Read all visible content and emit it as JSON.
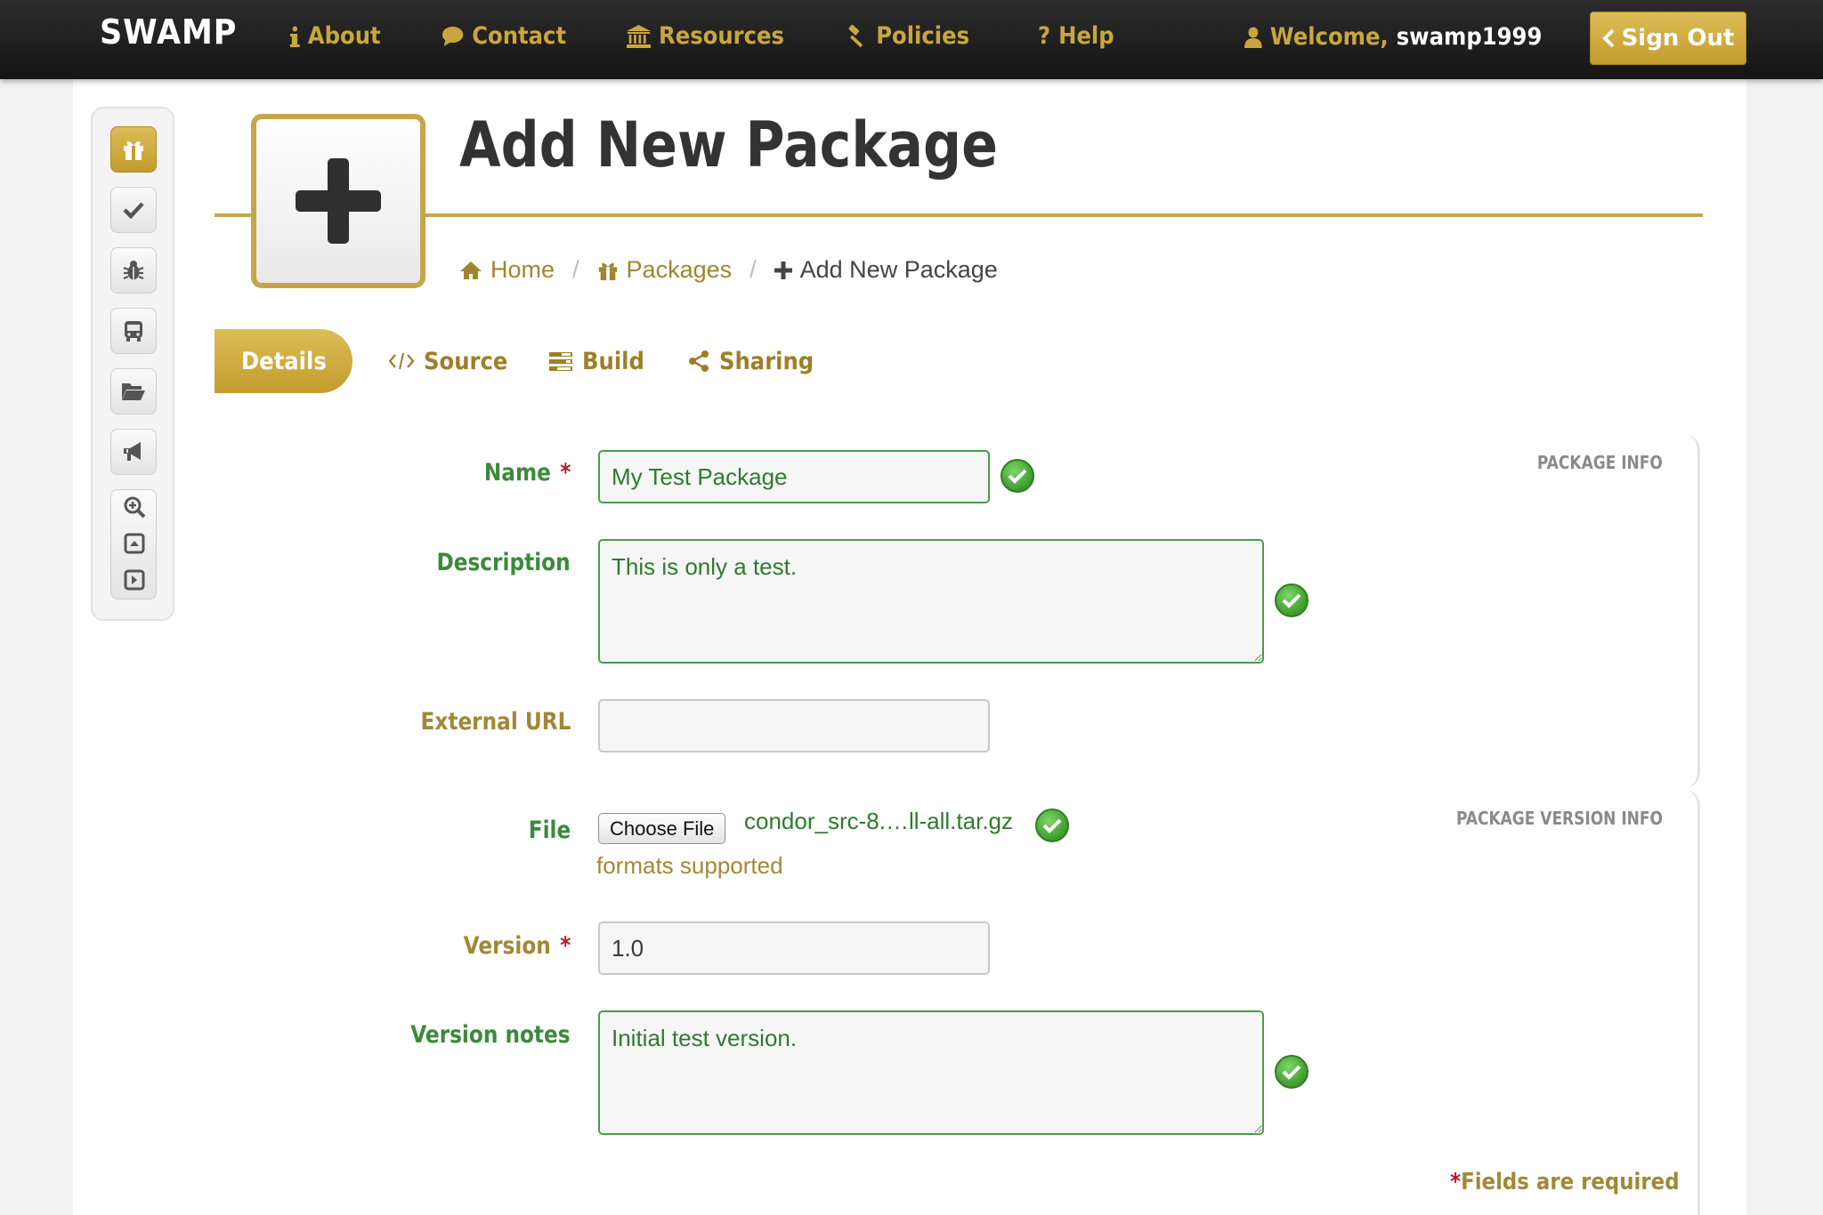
{
  "header": {
    "brand": "SWAMP",
    "nav": [
      {
        "label": "About",
        "icon": "info-icon"
      },
      {
        "label": "Contact",
        "icon": "chat-bubble-icon"
      },
      {
        "label": "Resources",
        "icon": "institution-icon"
      },
      {
        "label": "Policies",
        "icon": "gavel-icon"
      },
      {
        "label": "Help",
        "icon": "question-icon"
      }
    ],
    "welcome_prefix": "Welcome,",
    "username": "swamp1999",
    "sign_out_label": "Sign Out"
  },
  "sidebar": {
    "icons": [
      "gift-icon",
      "check-icon",
      "bug-icon",
      "bus-icon",
      "folder-open-icon",
      "bullhorn-icon",
      "zoom-in-icon",
      "collapse-up-icon",
      "expand-right-icon"
    ],
    "active": "gift-icon"
  },
  "page": {
    "title": "Add New Package",
    "breadcrumb": [
      {
        "label": "Home",
        "icon": "home-icon"
      },
      {
        "label": "Packages",
        "icon": "gift-icon"
      },
      {
        "label": "Add New Package",
        "icon": "plus-icon"
      }
    ]
  },
  "tabs": [
    {
      "label": "Details",
      "icon": "search-icon",
      "active": true
    },
    {
      "label": "Source",
      "icon": "code-icon",
      "active": false
    },
    {
      "label": "Build",
      "icon": "tasks-icon",
      "active": false
    },
    {
      "label": "Sharing",
      "icon": "share-icon",
      "active": false
    }
  ],
  "sections": {
    "package_info": "PACKAGE INFO",
    "package_version_info": "PACKAGE VERSION INFO"
  },
  "form": {
    "name": {
      "label": "Name",
      "value": "My Test Package",
      "required_mark": "*",
      "valid": true
    },
    "description": {
      "label": "Description",
      "value": "This is only a test.",
      "valid": true
    },
    "external_url": {
      "label": "External URL",
      "value": ""
    },
    "file": {
      "label": "File",
      "button_label": "Choose File",
      "file_name": "condor_src-8.…ll-all.tar.gz",
      "hint": "formats supported",
      "valid": true
    },
    "version": {
      "label": "Version",
      "value": "1.0",
      "required_mark": "*"
    },
    "version_notes": {
      "label": "Version notes",
      "value": "Initial test version.",
      "valid": true
    }
  },
  "required_note": {
    "star": "*",
    "text": "Fields are required"
  },
  "colors": {
    "gold": "#c6a64b",
    "valid_green": "#3b8a3b",
    "required_red": "#b0192e",
    "topbar": "#1e1e1e"
  }
}
